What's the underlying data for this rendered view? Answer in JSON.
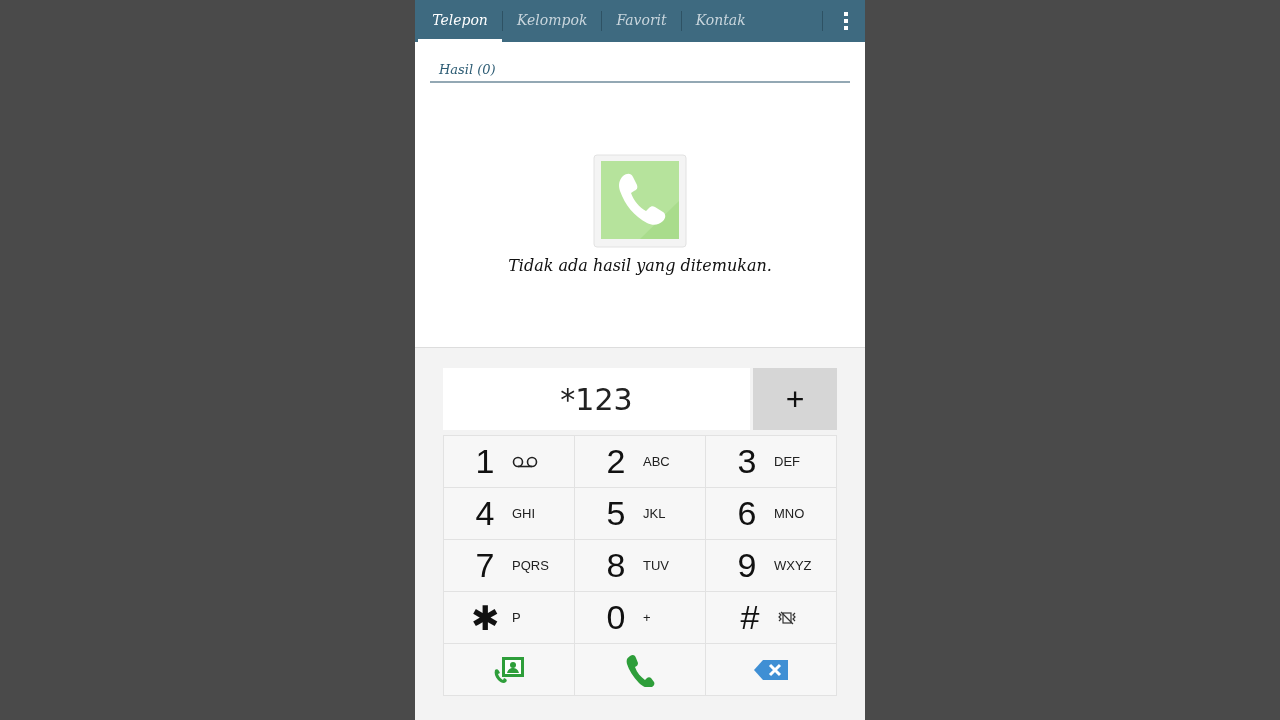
{
  "tabs": [
    {
      "label": "Telepon",
      "selected": true
    },
    {
      "label": "Kelompok",
      "selected": false
    },
    {
      "label": "Favorit",
      "selected": false
    },
    {
      "label": "Kontak",
      "selected": false
    }
  ],
  "results": {
    "header": "Hasil (0)",
    "empty_message": "Tidak ada hasil yang ditemukan."
  },
  "dial_field": {
    "value": "*123"
  },
  "add_button": "+",
  "keys": [
    {
      "digit": "1",
      "kind": "voicemail"
    },
    {
      "digit": "2",
      "kind": "text",
      "letters": "ABC"
    },
    {
      "digit": "3",
      "kind": "text",
      "letters": "DEF"
    },
    {
      "digit": "4",
      "kind": "text",
      "letters": "GHI"
    },
    {
      "digit": "5",
      "kind": "text",
      "letters": "JKL"
    },
    {
      "digit": "6",
      "kind": "text",
      "letters": "MNO"
    },
    {
      "digit": "7",
      "kind": "text",
      "letters": "PQRS"
    },
    {
      "digit": "8",
      "kind": "text",
      "letters": "TUV"
    },
    {
      "digit": "9",
      "kind": "text",
      "letters": "WXYZ"
    },
    {
      "digit": "✱",
      "kind": "text",
      "letters": "P"
    },
    {
      "digit": "0",
      "kind": "text",
      "letters": "+"
    },
    {
      "digit": "#",
      "kind": "vibrate"
    }
  ],
  "actions": [
    {
      "kind": "contacts"
    },
    {
      "kind": "call"
    },
    {
      "kind": "backspace"
    }
  ]
}
